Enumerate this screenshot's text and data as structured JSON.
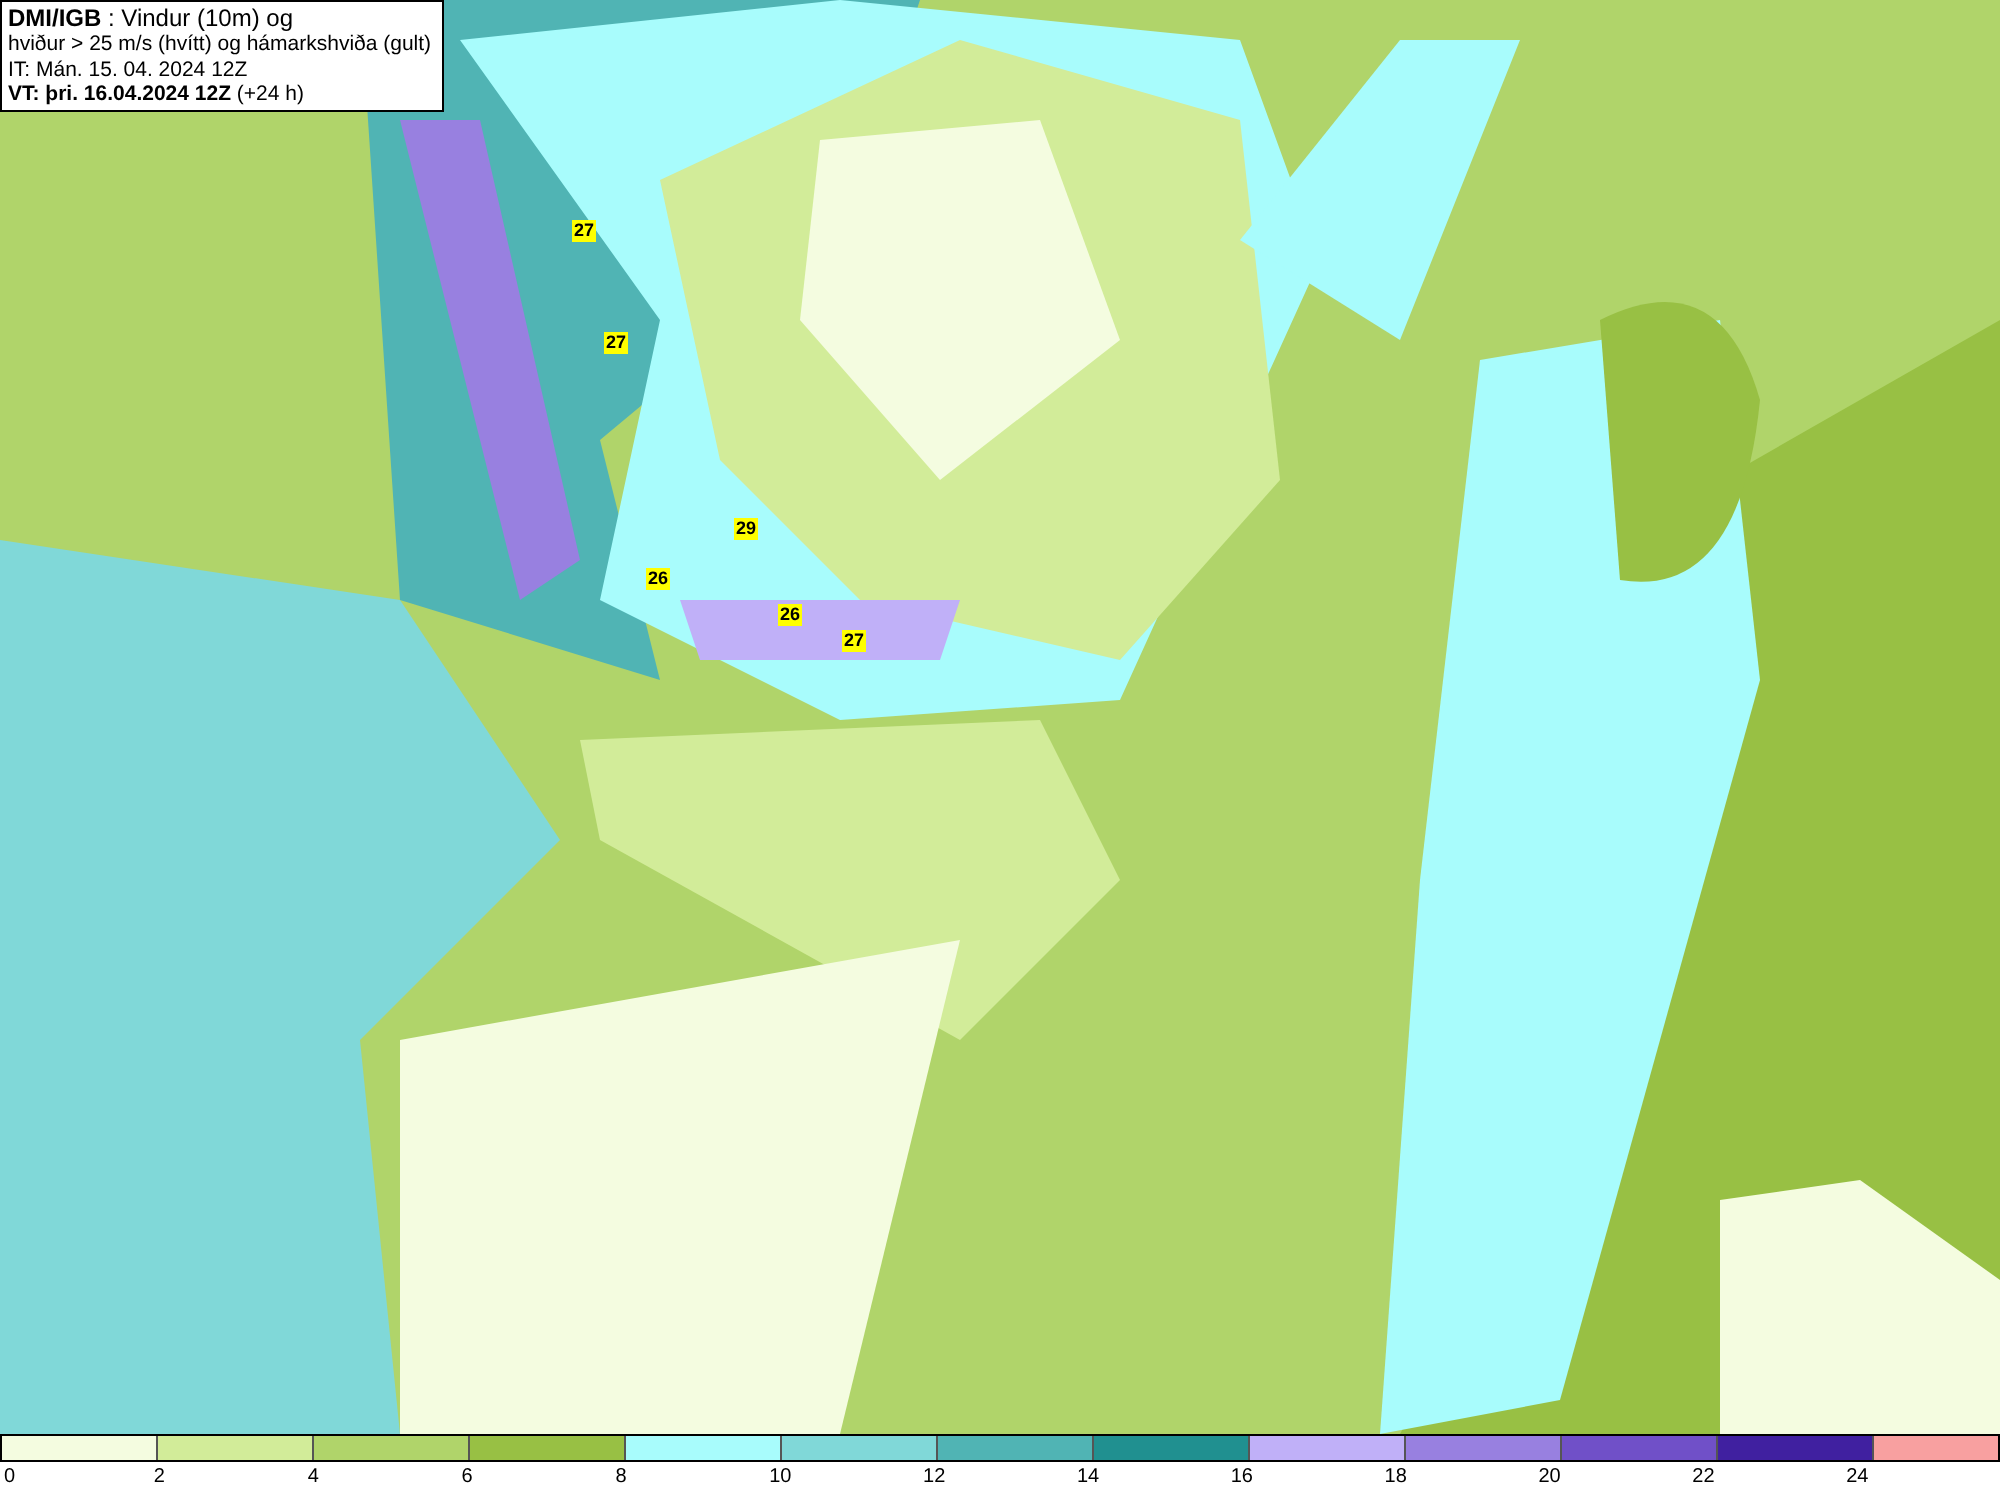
{
  "header": {
    "lines": [
      "**DMI/IGB** : Vindur (10m) og",
      "hviður > 25 m/s (hvítt) og hámarkshviða (gult)",
      "IT: Mán. 15. 04. 2024 12Z",
      "**VT: þri. 16.04.2024 12Z** (+24 h)"
    ]
  },
  "map": {
    "gusts": [
      "27",
      "27",
      "29",
      "26",
      "26",
      "27"
    ]
  },
  "legend": {
    "bins": [
      {
        "color": "#f4fce0"
      },
      {
        "color": "#d2ec99"
      },
      {
        "color": "#b0d46a"
      },
      {
        "color": "#98c044"
      },
      {
        "color": "#a8fcfc"
      },
      {
        "color": "#80d8d8"
      },
      {
        "color": "#50b4b4"
      },
      {
        "color": "#209090"
      },
      {
        "color": "#c0b0f8"
      },
      {
        "color": "#9880e0"
      },
      {
        "color": "#7050c8"
      },
      {
        "color": "#4020a0"
      },
      {
        "color": "#f8a0a0"
      }
    ],
    "ticks": [
      "0",
      "2",
      "4",
      "6",
      "8",
      "10",
      "12",
      "14",
      "16",
      "18",
      "20",
      "22",
      "24"
    ]
  }
}
